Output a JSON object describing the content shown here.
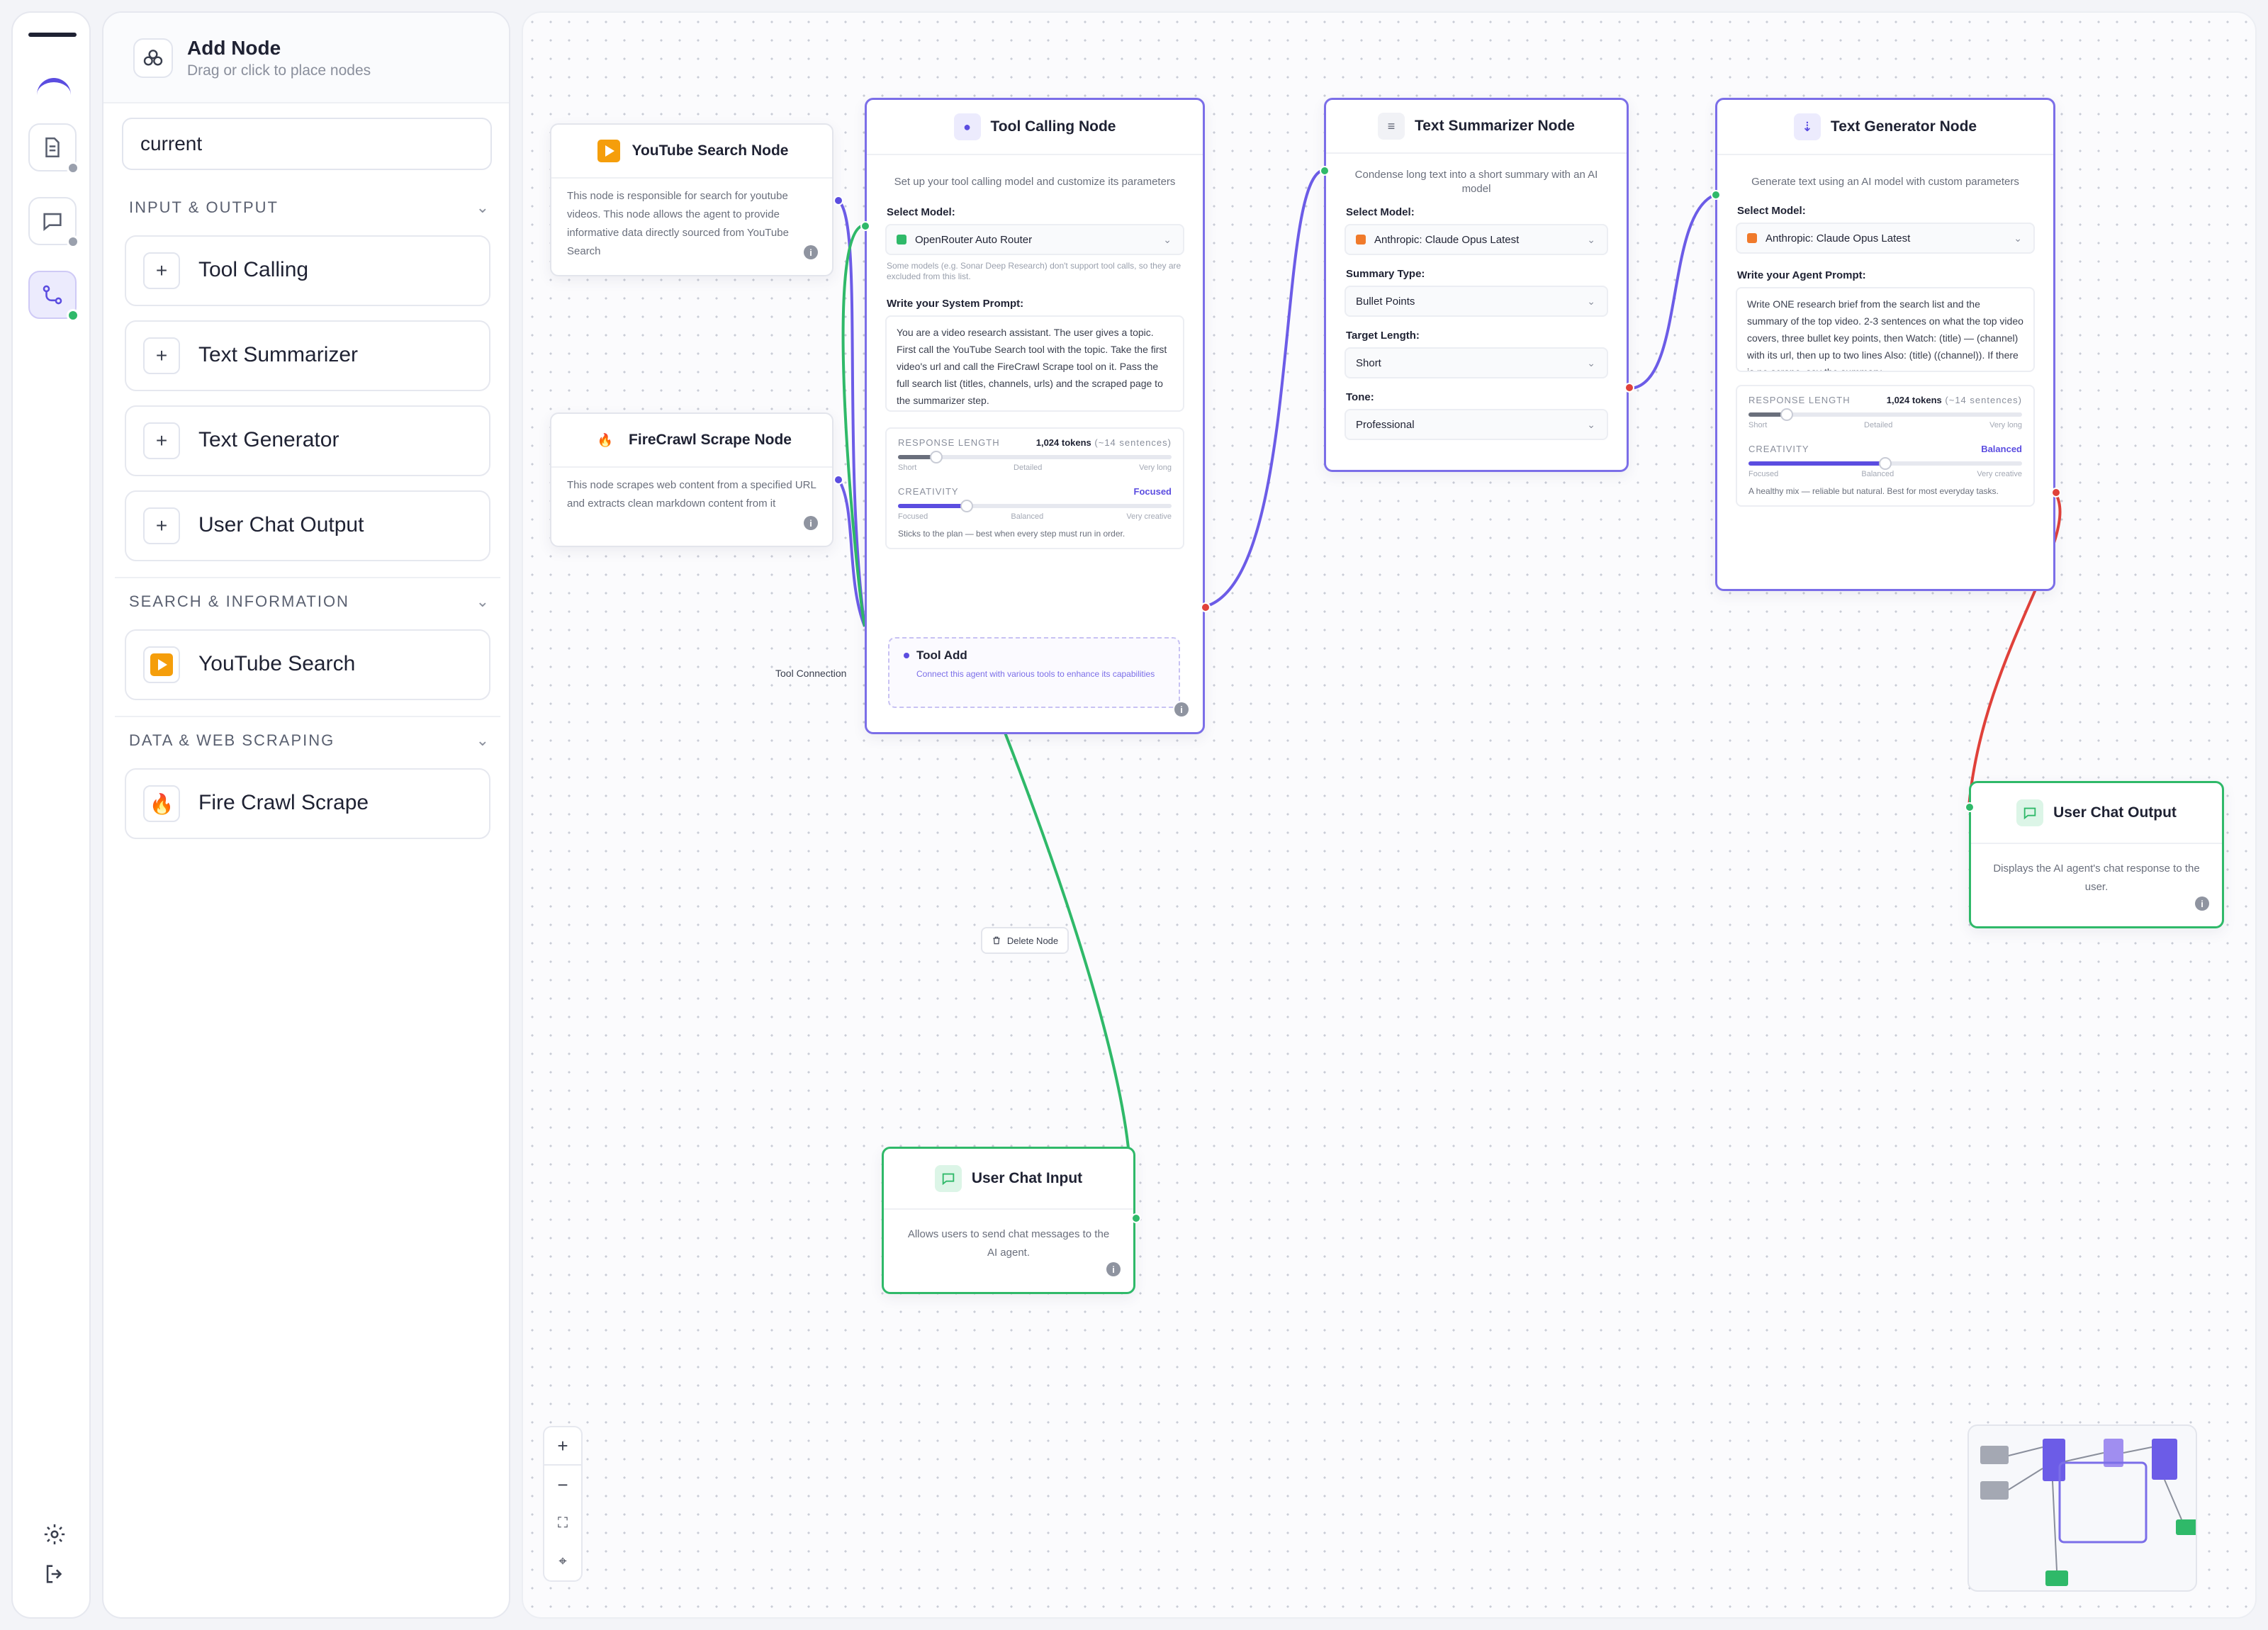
{
  "rail": {
    "icons": [
      "menu-bar",
      "logo-arc",
      "document-icon",
      "chat-icon",
      "workflow-icon",
      "gear-icon",
      "logout-icon"
    ]
  },
  "panel": {
    "title": "Add Node",
    "subtitle": "Drag or click to place nodes",
    "search_value": "current",
    "sections": [
      {
        "label": "INPUT & OUTPUT",
        "items": [
          "Tool Calling",
          "Text Summarizer",
          "Text Generator",
          "User Chat Output"
        ]
      },
      {
        "label": "SEARCH & INFORMATION",
        "items": [
          "YouTube Search"
        ]
      },
      {
        "label": "DATA & WEB SCRAPING",
        "items": [
          "Fire Crawl Scrape"
        ]
      }
    ]
  },
  "nodes": {
    "youtube": {
      "title": "YouTube Search Node",
      "desc": "This node is responsible for search for youtube videos. This node allows the agent to provide informative data directly sourced from YouTube Search"
    },
    "firecrawl": {
      "title": "FireCrawl Scrape Node",
      "desc": "This node scrapes web content from a specified URL and extracts clean markdown content from it"
    },
    "tool_calling": {
      "title": "Tool Calling Node",
      "desc": "Set up your tool calling model and customize its parameters",
      "model_label": "Select Model:",
      "model_value": "OpenRouter Auto Router",
      "model_hint": "Some models (e.g. Sonar Deep Research) don't support tool calls, so they are excluded from this list.",
      "prompt_label": "Write your System Prompt:",
      "prompt": "You are a video research assistant. The user gives a topic. First call the YouTube Search tool with the topic. Take the first video's url and call the FireCrawl Scrape tool on it. Pass the full search list (titles, channels, urls) and the scraped page to the summarizer step.",
      "response_length_label": "RESPONSE LENGTH",
      "response_length_value": "1,024 tokens",
      "response_length_sub": "(~14 sentences)",
      "length_ticks": [
        "Short",
        "Detailed",
        "Very long"
      ],
      "response_length_pct": 0.14,
      "creativity_label": "CREATIVITY",
      "creativity_value": "Focused",
      "creativity_pct": 0.25,
      "creativity_ticks": [
        "Focused",
        "Balanced",
        "Very creative"
      ],
      "creativity_note": "Sticks to the plan — best when every step must run in order.",
      "tool_add_title": "Tool Add",
      "tool_add_desc": "Connect this agent with various tools to enhance its capabilities"
    },
    "summarizer": {
      "title": "Text Summarizer Node",
      "desc": "Condense long text into a short summary with an AI model",
      "model_label": "Select Model:",
      "model_value": "Anthropic: Claude Opus Latest",
      "type_label": "Summary Type:",
      "type_value": "Bullet Points",
      "length_label": "Target Length:",
      "length_value": "Short",
      "tone_label": "Tone:",
      "tone_value": "Professional"
    },
    "generator": {
      "title": "Text Generator Node",
      "desc": "Generate text using an AI model with custom parameters",
      "model_label": "Select Model:",
      "model_value": "Anthropic: Claude Opus Latest",
      "prompt_label": "Write your Agent Prompt:",
      "prompt": "Write ONE research brief from the search list and the summary of the top video. 2-3 sentences on what the top video covers, three bullet key points, then Watch: (title) — (channel) with its url, then up to two lines Also: (title) ((channel)). If there is no scrape, say the summary",
      "response_length_label": "RESPONSE LENGTH",
      "response_length_value": "1,024 tokens",
      "response_length_sub": "(~14 sentences)",
      "length_ticks": [
        "Short",
        "Detailed",
        "Very long"
      ],
      "response_length_pct": 0.14,
      "creativity_label": "CREATIVITY",
      "creativity_value": "Balanced",
      "creativity_pct": 0.5,
      "creativity_ticks": [
        "Focused",
        "Balanced",
        "Very creative"
      ],
      "creativity_note": "A healthy mix — reliable but natural. Best for most everyday tasks."
    },
    "chat_output": {
      "title": "User Chat Output",
      "desc": "Displays the AI agent's chat response to the user."
    },
    "chat_input": {
      "title": "User Chat Input",
      "desc": "Allows users to send chat messages to the AI agent."
    }
  },
  "canvas": {
    "tool_connection_label": "Tool Connection",
    "delete_label": "Delete Node",
    "zoom_controls": [
      "+",
      "−",
      "⛶",
      "⌖"
    ]
  },
  "colors": {
    "accent": "#5b4de0",
    "tool_edge": "#2fb969",
    "output_edge": "#e0413a",
    "node_border": "#7b6ee8",
    "youtube": "#f59e0b"
  }
}
